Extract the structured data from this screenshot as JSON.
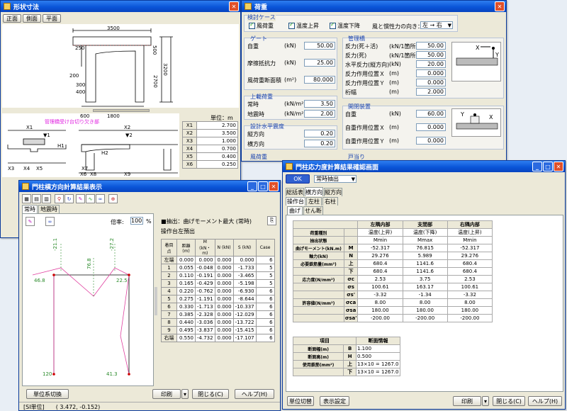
{
  "shape_win": {
    "title": "形状寸法",
    "tabs": [
      "正面",
      "側面",
      "平面"
    ],
    "dims": {
      "d3500": "3500",
      "d250": "250",
      "d200": "200",
      "d300": "300",
      "d400": "400",
      "d500": "500",
      "d2700": "2700",
      "d3200": "3200",
      "d600": "600",
      "d1800": "1800"
    },
    "unit": "単位：m",
    "note": "管理橋受け台切り欠き部",
    "xlabels": {
      "x1": "X1",
      "x2": "X2",
      "x3": "X3",
      "x4": "X4",
      "x5": "X5",
      "x6": "X6",
      "x7": "X7",
      "x8": "X8",
      "x9": "X9",
      "w1": "▼1",
      "w2": "▼2",
      "h1": "H1",
      "h2": "H2"
    },
    "dim_table": [
      [
        "X1",
        "2.700"
      ],
      [
        "X2",
        "3.500"
      ],
      [
        "X3",
        "1.000"
      ],
      [
        "X4",
        "0.700"
      ],
      [
        "X5",
        "0.400"
      ],
      [
        "X6",
        "0.250"
      ]
    ]
  },
  "load_win": {
    "title": "荷重",
    "case_group": "検討ケース",
    "checks": [
      "風荷重",
      "温度上昇",
      "温度下降"
    ],
    "wind_dir_label": "風と慣性力の向き：",
    "wind_dir": "左 → 右",
    "gate": {
      "title": "ゲート",
      "rows": [
        [
          "自重",
          "(kN)",
          "50.00"
        ],
        [
          "摩擦抵抗力",
          "(kN)",
          "25.00"
        ],
        [
          "風荷重断面積",
          "(m²)",
          "80.000"
        ]
      ]
    },
    "upper": {
      "title": "上載荷重",
      "rows": [
        [
          "常時",
          "(kN/m²)",
          "3.50"
        ],
        [
          "地震時",
          "(kN/m²)",
          "2.00"
        ]
      ]
    },
    "seismic": {
      "title": "設計水平震度",
      "rows": [
        [
          "縦方向",
          "",
          "0.20"
        ],
        [
          "横方向",
          "",
          "0.20"
        ]
      ]
    },
    "wind": {
      "title": "風荷重",
      "rows": [
        [
          "風荷重",
          ""
        ],
        [
          "温度荷重",
          ""
        ]
      ]
    },
    "bridge": {
      "title": "管理橋",
      "rows": [
        [
          "反力(死＋活)",
          "(kN/1箇所)",
          "50.00"
        ],
        [
          "反力(死)",
          "(kN/1箇所)",
          "50.00"
        ],
        [
          "水平反力(縦方向)",
          "(kN)",
          "20.00"
        ],
        [
          "反力作用位置Ｘ",
          "(m)",
          "0.000"
        ],
        [
          "反力作用位置Ｙ",
          "(m)",
          "0.000"
        ],
        [
          "桁幅",
          "(m)",
          "2.000"
        ]
      ]
    },
    "open": {
      "title": "開閉装置",
      "rows": [
        [
          "自重",
          "(kN)",
          "60.00"
        ],
        [
          "自重作用位置Ｘ",
          "(m)",
          "0.000"
        ],
        [
          "自重作用位置Ｙ",
          "(m)",
          "0.000"
        ]
      ]
    },
    "door": {
      "title": "戸当り"
    },
    "axis": {
      "x": "X",
      "y": "Y"
    }
  },
  "lat_win": {
    "title": "門柱横方向計算結果表示",
    "tabs": [
      "常時",
      "地震時"
    ],
    "zoom_label": "倍率:",
    "zoom": "100",
    "zoom_unit": "%",
    "heading": "■抽出：曲げモーメント最大 (常時)",
    "sub": "操作台左預出",
    "cols": [
      "着目点",
      "距離(m)",
      "M (kN・m)",
      "N (kN)",
      "S (kN)",
      "Case"
    ],
    "rows": [
      [
        "左端",
        "0.000",
        "0.000",
        "0.000",
        "0.000",
        "6"
      ],
      [
        "1",
        "0.055",
        "-0.048",
        "0.000",
        "-1.733",
        "5"
      ],
      [
        "2",
        "0.110",
        "-0.191",
        "0.000",
        "-3.465",
        "5"
      ],
      [
        "3",
        "0.165",
        "-0.429",
        "0.000",
        "-5.198",
        "5"
      ],
      [
        "4",
        "0.220",
        "-0.762",
        "0.000",
        "-6.930",
        "6"
      ],
      [
        "5",
        "0.275",
        "-1.191",
        "0.000",
        "-8.644",
        "6"
      ],
      [
        "6",
        "0.330",
        "-1.713",
        "0.000",
        "-10.337",
        "6"
      ],
      [
        "7",
        "0.385",
        "-2.328",
        "0.000",
        "-12.029",
        "6"
      ],
      [
        "8",
        "0.440",
        "-3.036",
        "0.000",
        "-13.722",
        "6"
      ],
      [
        "9",
        "0.495",
        "-3.837",
        "0.000",
        "-15.415",
        "6"
      ],
      [
        "右端",
        "0.550",
        "-4.732",
        "0.000",
        "-17.107",
        "6"
      ]
    ],
    "vals": {
      "v1": "-21.1",
      "v2": "76.8",
      "v3": "-27.2",
      "v4": "46.8",
      "v5": "22.5",
      "v6": "120",
      "v7": "41.3"
    },
    "buttons": {
      "unit": "単位系切換",
      "print": "印刷",
      "close": "閉じる(C)",
      "help": "ヘルプ(H)"
    },
    "status": {
      "unit": "[SI単位]",
      "coord": "( 3.472, -0.152)"
    }
  },
  "stress_win": {
    "title": "門柱応力度計算結果確認画面",
    "ok": "OK",
    "mode": "常時抽出",
    "tabs1": [
      "総括表",
      "横方向",
      "縦方向"
    ],
    "tabs2": [
      "操作台",
      "左柱",
      "右柱"
    ],
    "tabs3": [
      "曲げ",
      "せん断"
    ],
    "col_heads": [
      "左隅内部",
      "支間部",
      "右隅内部"
    ],
    "rows": [
      {
        "l": "荷重種別",
        "s": "",
        "v": [
          "温度(上昇)",
          "温度(下降)",
          "温度(上昇)"
        ]
      },
      {
        "l": "抽出状態",
        "s": "",
        "v": [
          "Mmin",
          "Mmax",
          "Mmin"
        ]
      },
      {
        "l": "曲げモーメント(kN.m)",
        "s": "M",
        "v": [
          "-52.317",
          "76.815",
          "-52.317"
        ]
      },
      {
        "l": "軸力(kN)",
        "s": "N",
        "v": [
          "29.276",
          "5.989",
          "29.276"
        ]
      },
      {
        "l": "必要鉄筋量(mm²)",
        "s": "上",
        "v": [
          "680.4",
          "1141.6",
          "680.4"
        ]
      },
      {
        "l": "",
        "s": "下",
        "v": [
          "680.4",
          "1141.6",
          "680.4"
        ]
      },
      {
        "l": "応力度(N/mm²)",
        "s": "σc",
        "v": [
          "2.53",
          "3.75",
          "2.53"
        ]
      },
      {
        "l": "",
        "s": "σs",
        "v": [
          "100.61",
          "163.17",
          "100.61"
        ]
      },
      {
        "l": "",
        "s": "σs'",
        "v": [
          "-3.32",
          "-1.34",
          "-3.32"
        ]
      },
      {
        "l": "許容値(N/mm²)",
        "s": "σca",
        "v": [
          "8.00",
          "8.00",
          "8.00"
        ]
      },
      {
        "l": "",
        "s": "σsa",
        "v": [
          "180.00",
          "180.00",
          "180.00"
        ]
      },
      {
        "l": "",
        "s": "σsa'",
        "v": [
          "-200.00",
          "-200.00",
          "-200.00"
        ]
      }
    ],
    "sec_heads": [
      "項目",
      "断面情報"
    ],
    "sec_rows": [
      {
        "l": "断面幅(m)",
        "s": "B",
        "v": "1.100"
      },
      {
        "l": "断面高(m)",
        "s": "H",
        "v": "0.500"
      },
      {
        "l": "使用鉄筋(mm²)",
        "s": "上",
        "v": "13×10 = 1267.0"
      },
      {
        "l": "",
        "s": "下",
        "v": "13×10 = 1267.0"
      }
    ],
    "buttons": {
      "unit": "単位切替",
      "disp": "表示設定",
      "print": "印刷",
      "close": "閉じる(C)",
      "help": "ヘルプ(H)"
    }
  }
}
